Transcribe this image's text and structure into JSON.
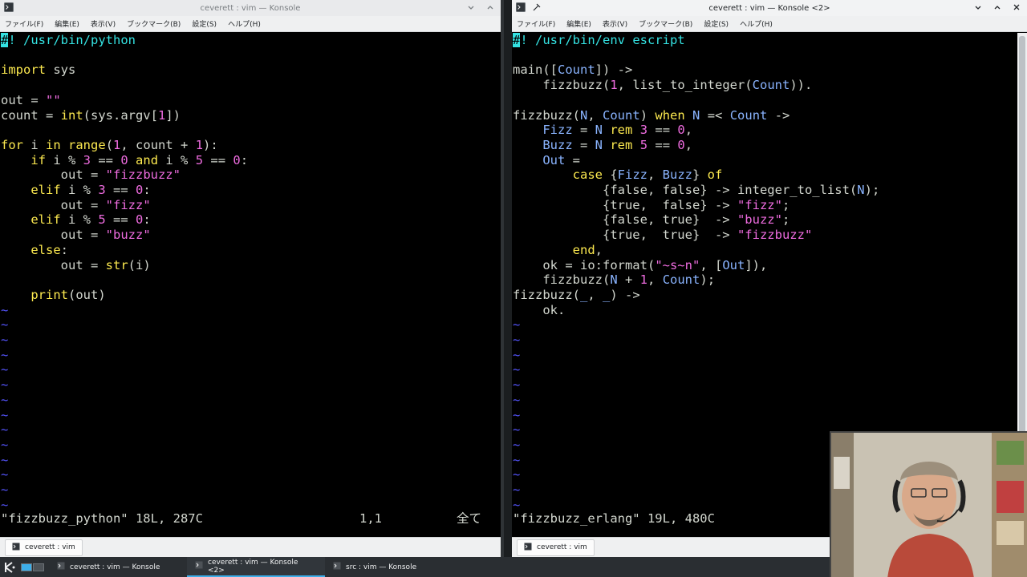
{
  "left_window": {
    "title": "ceverett : vim — Konsole",
    "menu": [
      "ファイル(F)",
      "編集(E)",
      "表示(V)",
      "ブックマーク(B)",
      "設定(S)",
      "ヘルプ(H)"
    ],
    "lines": [
      "! /usr/bin/python",
      "",
      "import sys",
      "",
      "out = \"\"",
      "count = int(sys.argv[1])",
      "",
      "for i in range(1, count + 1):",
      "    if i % 3 == 0 and i % 5 == 0:",
      "        out = \"fizzbuzz\"",
      "    elif i % 3 == 0:",
      "        out = \"fizz\"",
      "    elif i % 5 == 0:",
      "        out = \"buzz\"",
      "    else:",
      "        out = str(i)",
      "",
      "    print(out)"
    ],
    "cursor_char": "#",
    "status_file": "\"fizzbuzz_python\" 18L, 287C",
    "status_pos": "1,1",
    "status_all": "全て",
    "tab_label": "ceverett : vim"
  },
  "right_window": {
    "title": "ceverett : vim — Konsole <2>",
    "menu": [
      "ファイル(F)",
      "編集(E)",
      "表示(V)",
      "ブックマーク(B)",
      "設定(S)",
      "ヘルプ(H)"
    ],
    "lines": [
      "! /usr/bin/env escript",
      "",
      "main([Count]) ->",
      "    fizzbuzz(1, list_to_integer(Count)).",
      "",
      "fizzbuzz(N, Count) when N =< Count ->",
      "    Fizz = N rem 3 == 0,",
      "    Buzz = N rem 5 == 0,",
      "    Out =",
      "        case {Fizz, Buzz} of",
      "            {false, false} -> integer_to_list(N);",
      "            {true,  false} -> \"fizz\";",
      "            {false, true}  -> \"buzz\";",
      "            {true,  true}  -> \"fizzbuzz\"",
      "        end,",
      "    ok = io:format(\"~s~n\", [Out]),",
      "    fizzbuzz(N + 1, Count);",
      "fizzbuzz(_, _) ->",
      "    ok."
    ],
    "cursor_char": "#",
    "status_file": "\"fizzbuzz_erlang\" 19L, 480C",
    "tab_label": "ceverett : vim"
  },
  "taskbar": {
    "tasks": [
      {
        "label": "ceverett : vim — Konsole"
      },
      {
        "label": "ceverett : vim — Konsole <2>"
      },
      {
        "label": "src : vim — Konsole"
      }
    ]
  },
  "colors": {
    "cyan": "#34e2e2",
    "yellow": "#fce94f",
    "magenta": "#ef6ce0",
    "tilde": "#5555ff",
    "accent": "#3daee9"
  }
}
